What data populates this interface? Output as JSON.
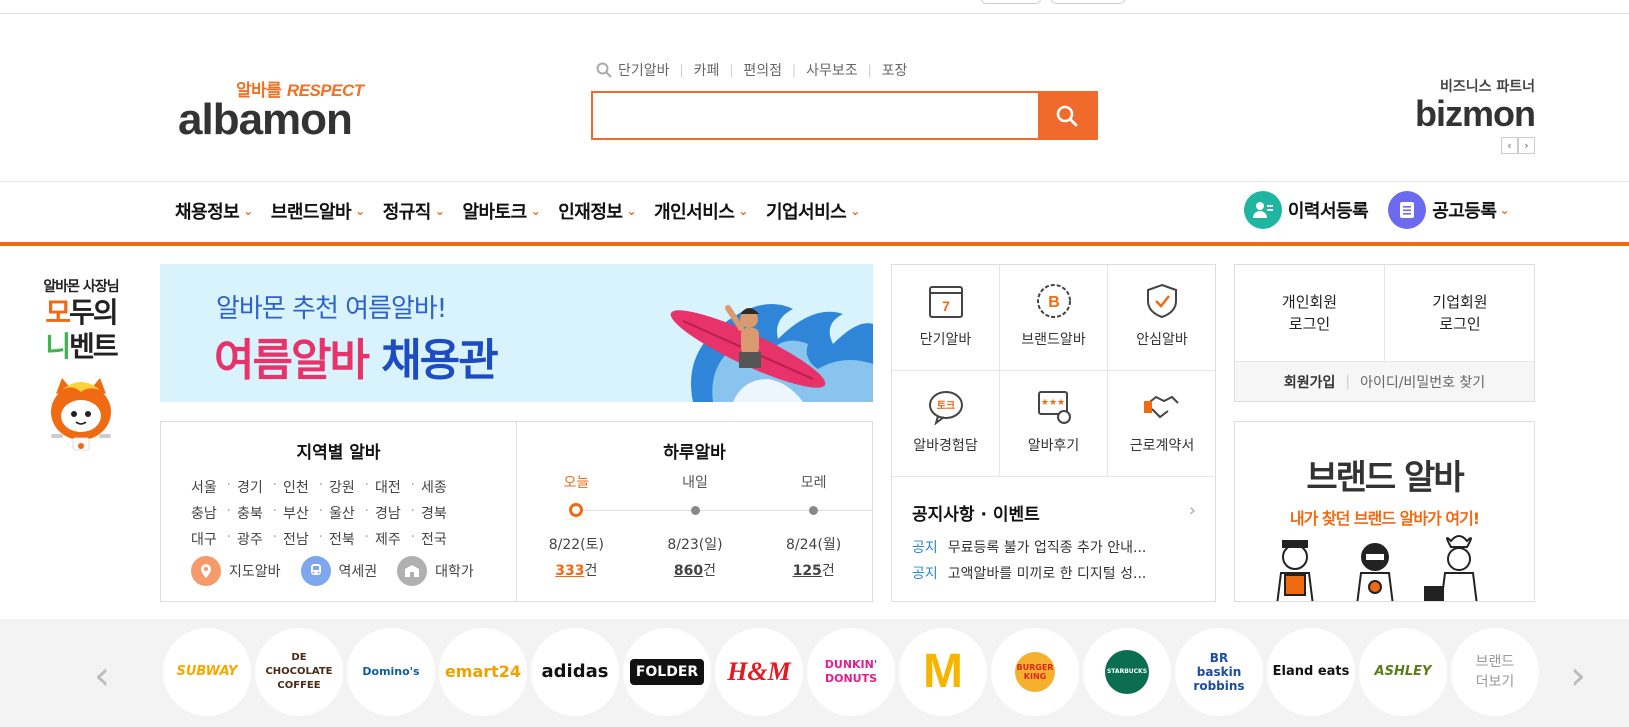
{
  "header": {
    "logo_tagline": "알바를 ",
    "logo_tagline_accent": "RESPECT",
    "logo_word": "albamon",
    "quick_keywords": [
      "단기알바",
      "카페",
      "편의점",
      "사무보조",
      "포장"
    ],
    "search_placeholder": "",
    "partner_sub": "비즈니스 파트너",
    "partner_word": "bizmon",
    "partner_prev": "‹",
    "partner_next": "›"
  },
  "gnb": {
    "menu": [
      "채용정보",
      "브랜드알바",
      "정규직",
      "알바토크",
      "인재정보",
      "개인서비스",
      "기업서비스"
    ],
    "resume_label": "이력서등록",
    "post_label": "공고등록"
  },
  "promo": {
    "line1": "알바몬 사장님",
    "line2a": "모",
    "line2b": "두의",
    "line3a": "니",
    "line3b": "벤트"
  },
  "banner": {
    "title": "알바몬 추천 여름알바!",
    "headline_a": "여름알바",
    "headline_b": "채용관"
  },
  "region": {
    "title": "지역별 알바",
    "cities": [
      "서울",
      "경기",
      "인천",
      "강원",
      "대전",
      "세종",
      "충남",
      "충북",
      "부산",
      "울산",
      "경남",
      "경북",
      "대구",
      "광주",
      "전남",
      "전북",
      "제주",
      "전국"
    ],
    "map_label": "지도알바",
    "station_label": "역세권",
    "univ_label": "대학가"
  },
  "daily": {
    "title": "하루알바",
    "days": [
      {
        "label": "오늘",
        "date": "8/22(토)",
        "count": "333",
        "unit": "건"
      },
      {
        "label": "내일",
        "date": "8/23(일)",
        "count": "860",
        "unit": "건"
      },
      {
        "label": "모레",
        "date": "8/24(월)",
        "count": "125",
        "unit": "건"
      }
    ]
  },
  "services": {
    "items": [
      "단기알바",
      "브랜드알바",
      "안심알바",
      "알바경험담",
      "알바후기",
      "근로계약서"
    ],
    "notice_title": "공지사항 · 이벤트",
    "notices": [
      {
        "tag": "공지",
        "text": "무료등록 불가 업직종 추가 안내..."
      },
      {
        "tag": "공지",
        "text": "고액알바를 미끼로 한 디지털 성..."
      }
    ]
  },
  "login": {
    "personal_1": "개인회원",
    "personal_2": "로그인",
    "company_1": "기업회원",
    "company_2": "로그인",
    "signup": "회원가입",
    "find": "아이디/비밀번호 찾기"
  },
  "brand_promo": {
    "title": "브랜드 알바",
    "subtitle": "내가 찾던 브랜드 알바가 여기!"
  },
  "brands": {
    "prev": "‹",
    "next": "›",
    "items": [
      "SUBWAY",
      "DE CHOCOLATE COFFEE",
      "Domino's",
      "emart24",
      "adidas",
      "FOLDER",
      "H&M",
      "DUNKIN' DONUTS",
      "M",
      "BURGER KING",
      "STARBUCKS",
      "BR baskin robbins",
      "Eland eats",
      "ASHLEY"
    ],
    "more_1": "브랜드",
    "more_2": "더보기"
  },
  "colors": {
    "accent": "#f06a14",
    "search": "#f06a2c",
    "resume_icon": "#1fb5a0",
    "post_icon": "#6c6bf0",
    "notice_tag": "#2a8ad6"
  }
}
